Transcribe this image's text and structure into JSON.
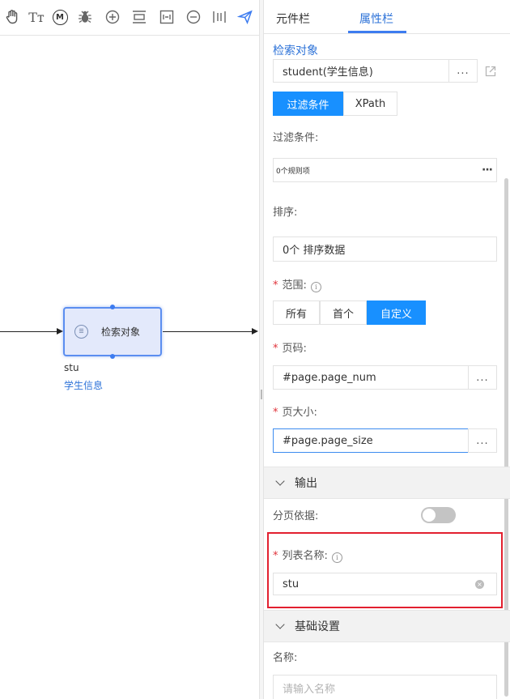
{
  "toolbar": {
    "tools": [
      {
        "icon": "hand-icon"
      },
      {
        "icon": "text-size-icon"
      },
      {
        "icon": "m-circle-icon",
        "glyph": "M"
      },
      {
        "icon": "bug-icon"
      },
      {
        "icon": "zoom-in-icon"
      },
      {
        "icon": "align-icon"
      },
      {
        "icon": "fit-screen-icon"
      },
      {
        "icon": "zoom-out-icon"
      },
      {
        "icon": "distribute-icon"
      },
      {
        "icon": "send-icon"
      }
    ],
    "text_size_glyph": "Tт"
  },
  "canvas": {
    "node": {
      "label": "检索对象",
      "icon_glyph": "☰",
      "name": "stu",
      "subtitle": "学生信息"
    }
  },
  "panel": {
    "tabs": [
      {
        "label": "元件栏"
      },
      {
        "label": "属性栏"
      }
    ],
    "active_tab": "属性栏",
    "title": "检索对象",
    "entity_field": {
      "value": "student(学生信息)",
      "button": "...",
      "icon": "open-link-icon"
    },
    "mode_tabs": [
      {
        "label": "过滤条件",
        "active": true
      },
      {
        "label": "XPath",
        "active": false
      }
    ],
    "filter": {
      "label": "过滤条件:",
      "value": "0个规则项",
      "button": "···"
    },
    "sort": {
      "label": "排序:",
      "value": "0个 排序数据"
    },
    "range": {
      "label": "范围:",
      "required_mark": "*",
      "options": [
        {
          "label": "所有",
          "active": false
        },
        {
          "label": "首个",
          "active": false
        },
        {
          "label": "自定义",
          "active": true
        }
      ]
    },
    "page_num": {
      "label": "页码:",
      "required_mark": "*",
      "value": "#page.page_num",
      "button": "..."
    },
    "page_size": {
      "label": "页大小:",
      "required_mark": "*",
      "value": "#page.page_size",
      "button": "..."
    },
    "output_section": {
      "title": "输出"
    },
    "paging_basis": {
      "label": "分页依据:",
      "enabled": false
    },
    "list_name": {
      "label": "列表名称:",
      "required_mark": "*",
      "value": "stu",
      "clear": "×"
    },
    "basic_section": {
      "title": "基础设置"
    },
    "name_field": {
      "label": "名称:",
      "placeholder": "请输入名称"
    }
  },
  "colors": {
    "accent": "#1890ff",
    "link": "#2e73d8",
    "required": "#e0323a",
    "highlight_box": "#e2202f",
    "node_fill": "#e3e9fb",
    "node_border": "#5b8ef0"
  }
}
